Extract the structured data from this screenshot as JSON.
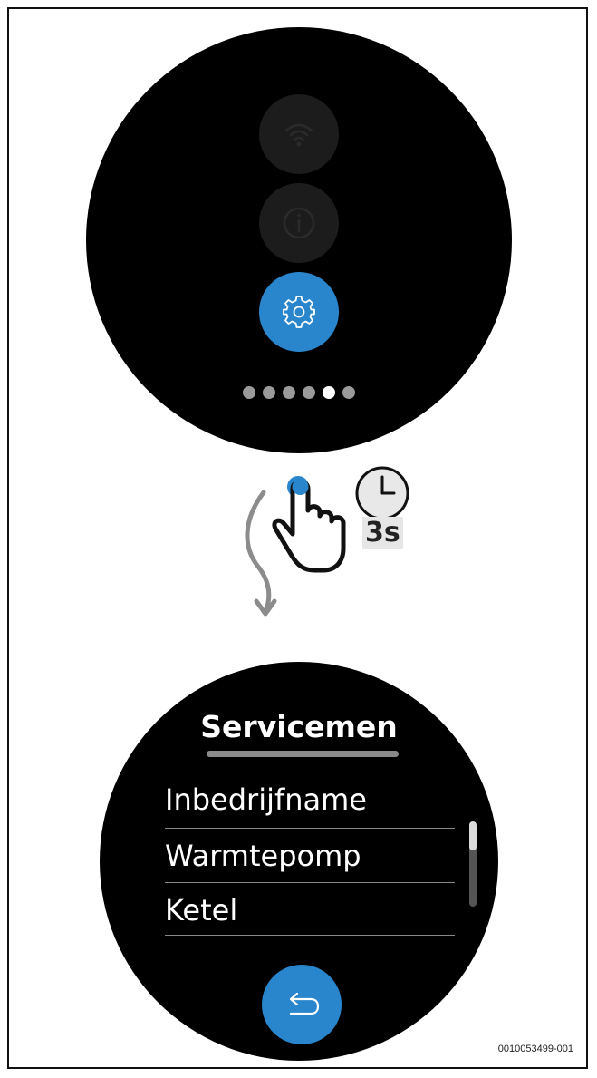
{
  "colors": {
    "accent": "#2a86cc",
    "inactive_button": "#1c1c1c",
    "screen_bg": "#000000",
    "dot_active": "#ffffff",
    "dot_inactive": "#9a9a9a",
    "arrow": "#8c8c8c"
  },
  "top_screen": {
    "buttons": [
      {
        "icon": "wifi-icon",
        "active": false
      },
      {
        "icon": "info-icon",
        "active": false
      },
      {
        "icon": "gear-icon",
        "active": true
      }
    ],
    "page_indicator": {
      "total": 6,
      "active_index": 4
    }
  },
  "gesture": {
    "hand_icon": "hand-press-icon",
    "clock_icon": "clock-icon",
    "duration_label": "3s",
    "arrow_icon": "curved-arrow-down-icon"
  },
  "bottom_screen": {
    "title": "Servicemen",
    "menu_items": [
      "Inbedrijfname",
      "Warmtepomp",
      "Ketel"
    ],
    "back_icon": "back-arrow-icon"
  },
  "figure_id": "0010053499-001"
}
